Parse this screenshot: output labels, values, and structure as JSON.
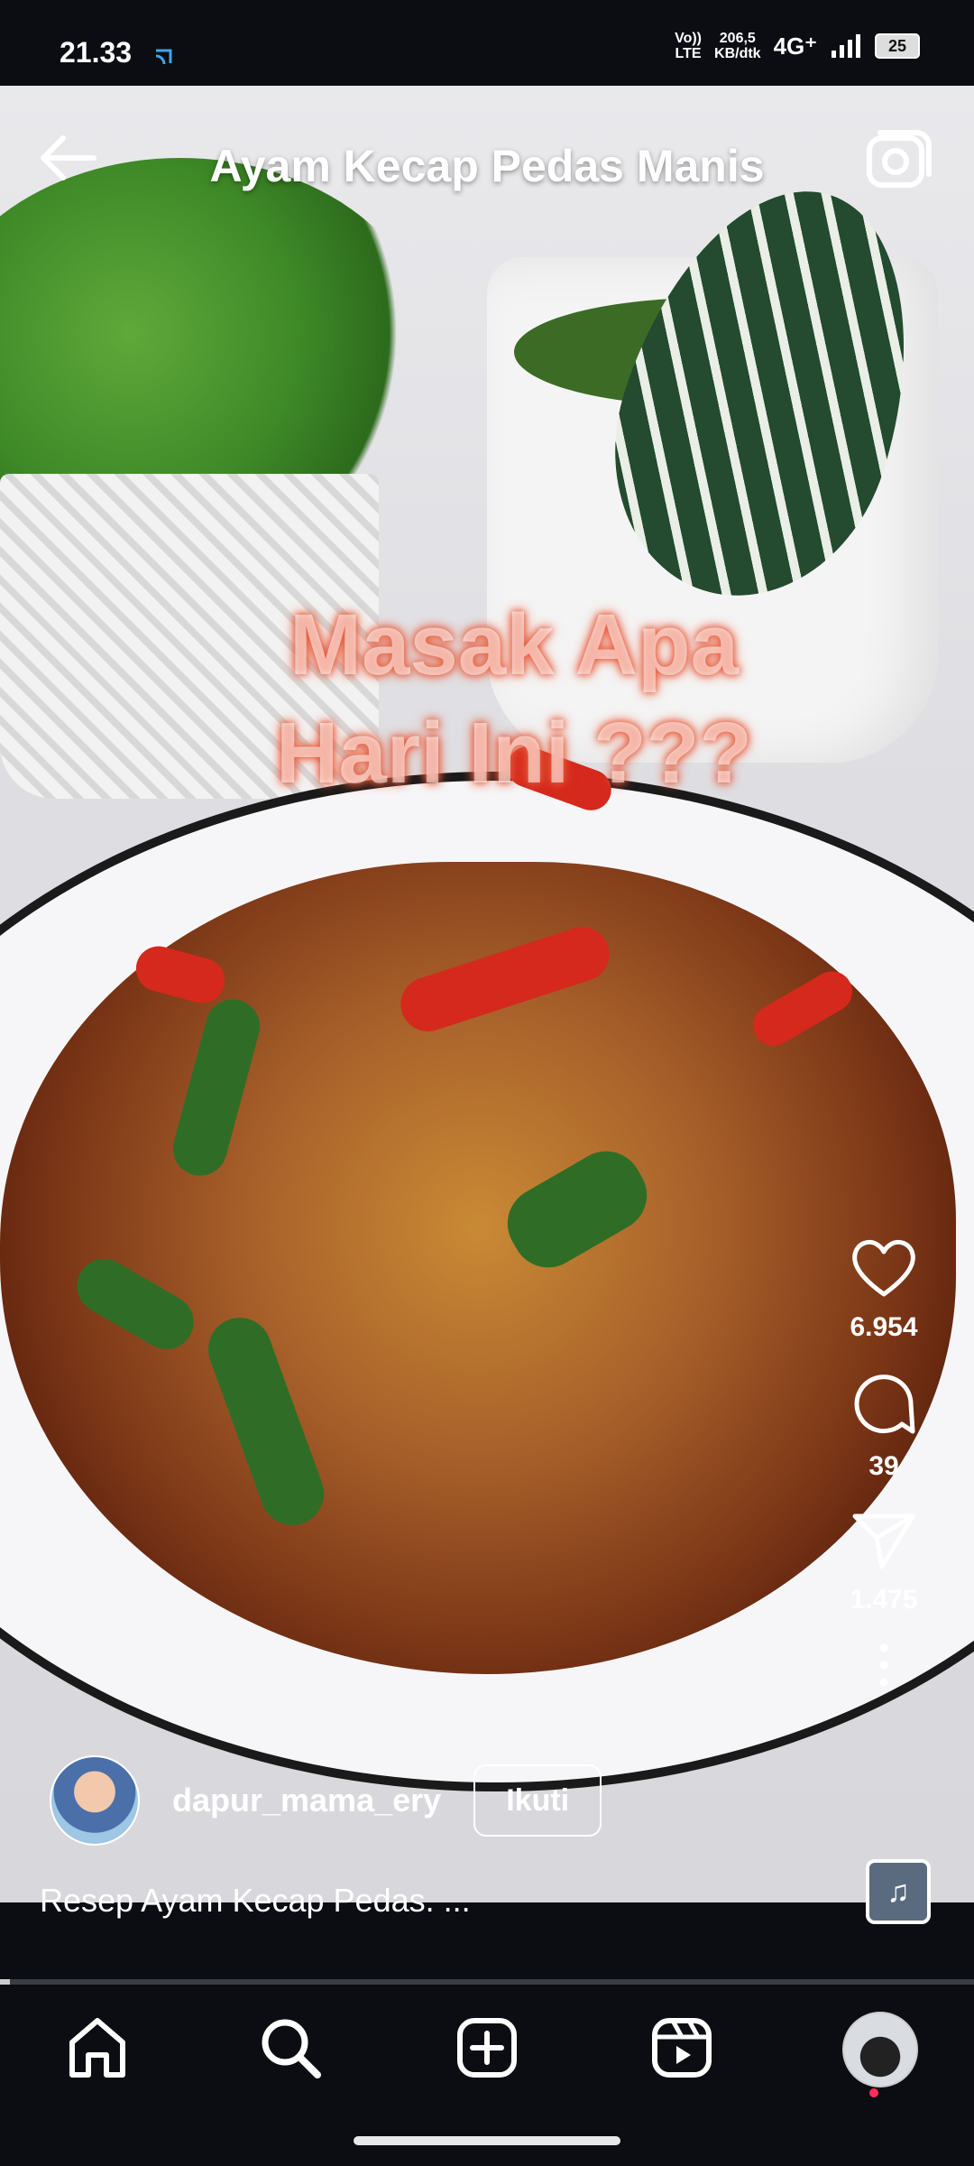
{
  "status": {
    "time": "21.33",
    "volte_top": "Vo))",
    "volte_bottom": "LTE",
    "speed_top": "206,5",
    "speed_bottom": "KB/dtk",
    "network": "4G⁺",
    "battery": "25"
  },
  "header": {
    "title": "Ayam Kecap Pedas Manis"
  },
  "video": {
    "overlay_line1": "Masak Apa",
    "overlay_line2": "Hari Ini ???"
  },
  "actions": {
    "likes": "6.954",
    "comments": "39",
    "shares": "1.475"
  },
  "author": {
    "username": "dapur_mama_ery",
    "follow_label": "Ikuti"
  },
  "description": "Resep Ayam Kecap Pedas. ...",
  "progress": {
    "fraction": 0.01
  },
  "icons": {
    "back": "arrow-left-icon",
    "camera": "camera-icon",
    "like": "heart-icon",
    "comment": "comment-bubble-icon",
    "share": "send-icon",
    "more": "more-vertical-icon",
    "audio": "music-note-icon",
    "home": "home-icon",
    "search": "search-icon",
    "create": "plus-square-icon",
    "reels": "reels-icon",
    "profile": "profile-avatar"
  },
  "colors": {
    "background": "#0b0d12",
    "notification_dot": "#ff2f56",
    "chili": "#d4291c"
  }
}
